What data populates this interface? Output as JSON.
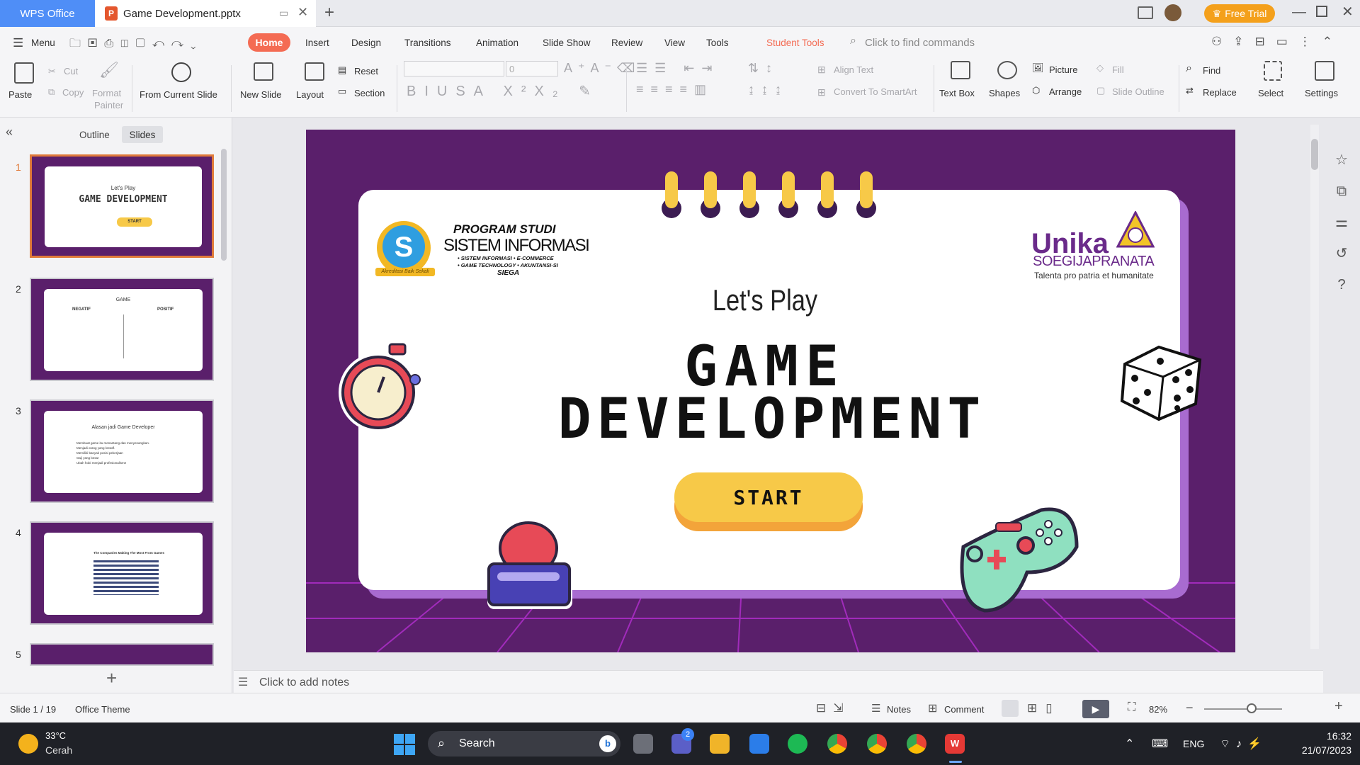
{
  "titlebar": {
    "app_tab": "WPS Office",
    "doc_tab": "Game Development.pptx",
    "free_trial": "Free Trial"
  },
  "menu": {
    "menu_label": "Menu",
    "tabs": [
      "Home",
      "Insert",
      "Design",
      "Transitions",
      "Animation",
      "Slide Show",
      "Review",
      "View",
      "Tools",
      "Student Tools"
    ],
    "search_placeholder": "Click to find commands"
  },
  "ribbon": {
    "paste": "Paste",
    "cut": "Cut",
    "copy": "Copy",
    "format_painter_1": "Format",
    "format_painter_2": "Painter",
    "from_current_slide": "From Current Slide",
    "new_slide": "New Slide",
    "layout": "Layout",
    "reset": "Reset",
    "section": "Section",
    "font_size": "0",
    "align_text": "Align Text",
    "convert_smartart": "Convert To SmartArt",
    "text_box": "Text Box",
    "shapes": "Shapes",
    "picture": "Picture",
    "arrange": "Arrange",
    "fill": "Fill",
    "slide_outline": "Slide Outline",
    "find": "Find",
    "replace": "Replace",
    "select": "Select",
    "settings": "Settings"
  },
  "leftpanel": {
    "outline_tab": "Outline",
    "slides_tab": "Slides",
    "thumbnails": [
      {
        "num": "1",
        "title": "Let's Play",
        "subtitle": "GAME DEVELOPMENT",
        "start": "START"
      },
      {
        "num": "2",
        "title": "GAME",
        "left": "NEGATIF",
        "right": "POSITIF"
      },
      {
        "num": "3",
        "title": "Alasan jadi Game Developer",
        "bullets": [
          "Membuat game itu menantang dan menyenangkan.",
          "Menjadi orang yang kreatif.",
          "Memiliki banyak posisi pekerjaan",
          "Gaji yang besar",
          "Ubah hobi menjadi profesionalisme"
        ]
      },
      {
        "num": "4",
        "title": "The Companies Making The Most From Games"
      },
      {
        "num": "5"
      }
    ]
  },
  "slide": {
    "prodi_title": "PROGRAM STUDI",
    "prodi_name": "SISTEM INFORMASI",
    "prodi_sub1": "• SISTEM INFORMASI • E-COMMERCE",
    "prodi_sub2": "• GAME TECHNOLOGY • AKUNTANSI-SI",
    "prodi_sub3": "SIEGA",
    "badge_text": "Akreditasi Baik Sekali",
    "unika_1": "Unika",
    "unika_2": "SOEGIJAPRANATA",
    "unika_tagline": "Talenta pro patria et humanitate",
    "lets_play": "Let's Play",
    "title_1": "GAME",
    "title_2": "DEVELOPMENT",
    "start": "START"
  },
  "notes_placeholder": "Click to add notes",
  "status": {
    "slide_counter": "Slide 1 / 19",
    "theme": "Office Theme",
    "notes": "Notes",
    "comment": "Comment",
    "zoom": "82%"
  },
  "taskbar": {
    "temp": "33°C",
    "weather": "Cerah",
    "search": "Search",
    "badge": "2",
    "lang": "ENG",
    "time": "16:32",
    "date": "21/07/2023"
  },
  "colors": {
    "accent": "#f46b53",
    "wps_blue": "#4f8ef7",
    "slide_purple": "#5a1f6b",
    "start_yellow": "#f7c948"
  }
}
